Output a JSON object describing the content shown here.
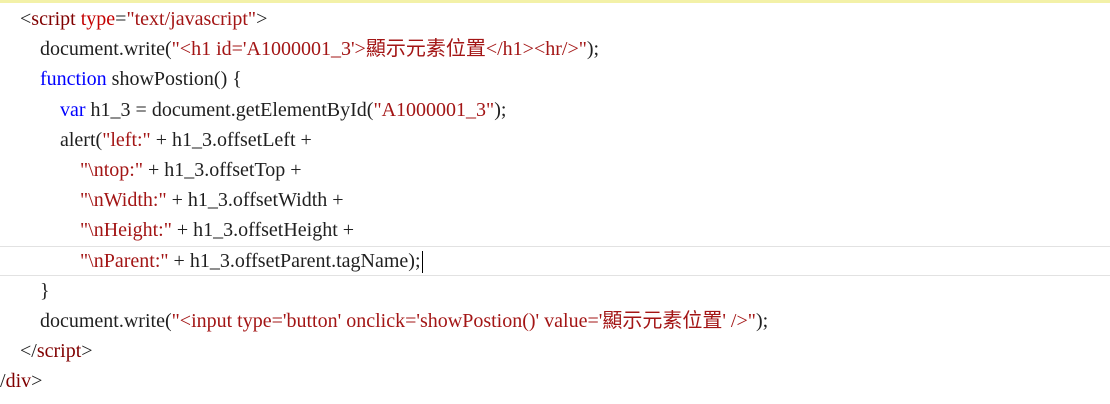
{
  "code_lines": [
    {
      "indent": "    ",
      "tokens": [
        {
          "t": "<",
          "c": "punct"
        },
        {
          "t": "script",
          "c": "tag"
        },
        {
          "t": " ",
          "c": "plain"
        },
        {
          "t": "type",
          "c": "attr"
        },
        {
          "t": "=",
          "c": "punct"
        },
        {
          "t": "\"text/javascript\"",
          "c": "str"
        },
        {
          "t": ">",
          "c": "punct"
        }
      ]
    },
    {
      "indent": "        ",
      "tokens": [
        {
          "t": "document.write(",
          "c": "plain"
        },
        {
          "t": "\"<h1 id='A1000001_3'>顯示元素位置</h1><hr/>\"",
          "c": "str"
        },
        {
          "t": ");",
          "c": "plain"
        }
      ]
    },
    {
      "indent": "        ",
      "tokens": [
        {
          "t": "function",
          "c": "kw"
        },
        {
          "t": " showPostion() {",
          "c": "plain"
        }
      ]
    },
    {
      "indent": "            ",
      "tokens": [
        {
          "t": "var",
          "c": "kw"
        },
        {
          "t": " h1_3 = document.getElementById(",
          "c": "plain"
        },
        {
          "t": "\"A1000001_3\"",
          "c": "str"
        },
        {
          "t": ");",
          "c": "plain"
        }
      ]
    },
    {
      "indent": "            ",
      "tokens": [
        {
          "t": "alert(",
          "c": "plain"
        },
        {
          "t": "\"left:\"",
          "c": "str"
        },
        {
          "t": " + h1_3.offsetLeft +",
          "c": "plain"
        }
      ]
    },
    {
      "indent": "                ",
      "tokens": [
        {
          "t": "\"\\ntop:\"",
          "c": "str"
        },
        {
          "t": " + h1_3.offsetTop +",
          "c": "plain"
        }
      ]
    },
    {
      "indent": "                ",
      "tokens": [
        {
          "t": "\"\\nWidth:\"",
          "c": "str"
        },
        {
          "t": " + h1_3.offsetWidth +",
          "c": "plain"
        }
      ]
    },
    {
      "indent": "                ",
      "tokens": [
        {
          "t": "\"\\nHeight:\"",
          "c": "str"
        },
        {
          "t": " + h1_3.offsetHeight +",
          "c": "plain"
        }
      ]
    },
    {
      "indent": "                ",
      "current": true,
      "tokens": [
        {
          "t": "\"\\nParent:\"",
          "c": "str"
        },
        {
          "t": " + h1_3.offsetParent.tagName);",
          "c": "plain"
        }
      ]
    },
    {
      "indent": "        ",
      "tokens": [
        {
          "t": "}",
          "c": "plain"
        }
      ]
    },
    {
      "indent": "        ",
      "tokens": [
        {
          "t": "document.write(",
          "c": "plain"
        },
        {
          "t": "\"<input type='button' onclick='showPostion()' value='顯示元素位置' />\"",
          "c": "str"
        },
        {
          "t": ");",
          "c": "plain"
        }
      ]
    },
    {
      "indent": "    ",
      "tokens": [
        {
          "t": "</",
          "c": "punct"
        },
        {
          "t": "script",
          "c": "tag"
        },
        {
          "t": ">",
          "c": "punct"
        }
      ]
    },
    {
      "indent": "",
      "tokens": [
        {
          "t": "/",
          "c": "punct"
        },
        {
          "t": "div",
          "c": "tag"
        },
        {
          "t": ">",
          "c": "punct"
        }
      ]
    }
  ]
}
